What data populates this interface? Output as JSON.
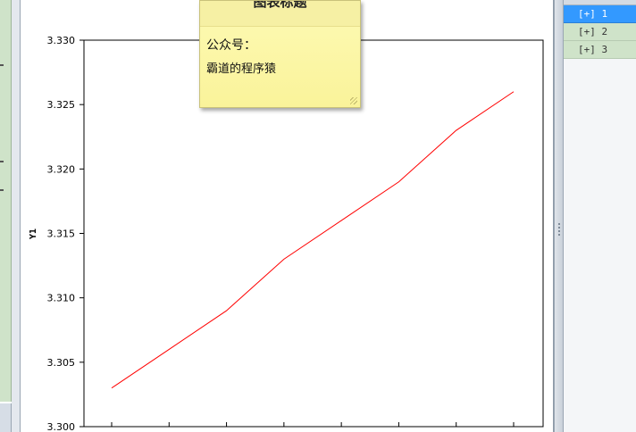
{
  "note": {
    "title": "图表标题",
    "line1": "公众号：",
    "line2": "霸道的程序猿"
  },
  "list": {
    "items": [
      {
        "label": "[+] 1",
        "selected": true
      },
      {
        "label": "[+] 2",
        "selected": false
      },
      {
        "label": "[+] 3",
        "selected": false
      }
    ]
  },
  "colors": {
    "series": "#ff0000",
    "selected_row": "#3399ff",
    "panel_green": "#cfe3c9",
    "note_yellow": "#faf39a"
  },
  "chart_data": {
    "type": "line",
    "ylabel": "Y1",
    "ylim": [
      3.3,
      3.33
    ],
    "yticks": [
      3.33,
      3.325,
      3.32,
      3.315,
      3.31,
      3.305,
      3.3
    ],
    "x": [
      1,
      2,
      3,
      4,
      5,
      6,
      7,
      8
    ],
    "series": [
      {
        "values": [
          3.303,
          3.306,
          3.309,
          3.313,
          3.316,
          3.319,
          3.323,
          3.326
        ]
      }
    ],
    "grid": false
  }
}
